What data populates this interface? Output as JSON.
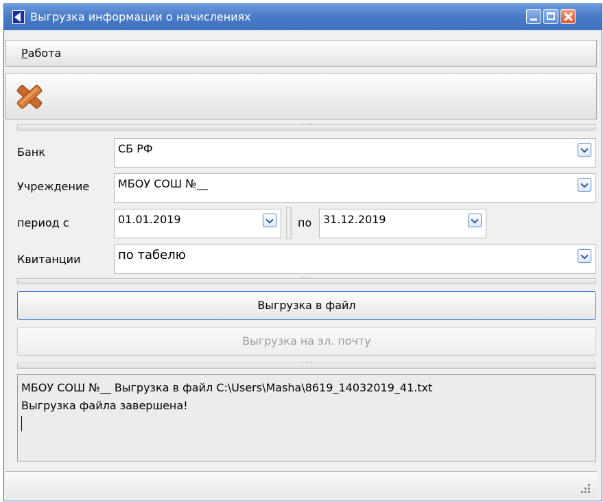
{
  "window": {
    "title": "Выгрузка информации о начислениях"
  },
  "menu": {
    "items": [
      {
        "label_prefix": "Р",
        "label_rest": "абота"
      }
    ]
  },
  "toolbar": {
    "close_icon": "close-x-icon",
    "accent_color": "#c96a2b"
  },
  "form": {
    "bank_label": "Банк",
    "bank_value": "СБ РФ",
    "institution_label": "Учреждение",
    "institution_value": "МБОУ СОШ №__",
    "period_label": "период с",
    "period_from": "01.01.2019",
    "period_to_label": "по",
    "period_to": "31.12.2019",
    "receipts_label": "Квитанции",
    "receipts_value": "по табелю"
  },
  "actions": {
    "export_file": "Выгрузка в файл",
    "export_email": "Выгрузка на эл. почту"
  },
  "log": {
    "line1": "МБОУ СОШ №__ Выгрузка в файл C:\\Users\\Masha\\8619_14032019_41.txt",
    "line2": "Выгрузка файла завершена!"
  }
}
